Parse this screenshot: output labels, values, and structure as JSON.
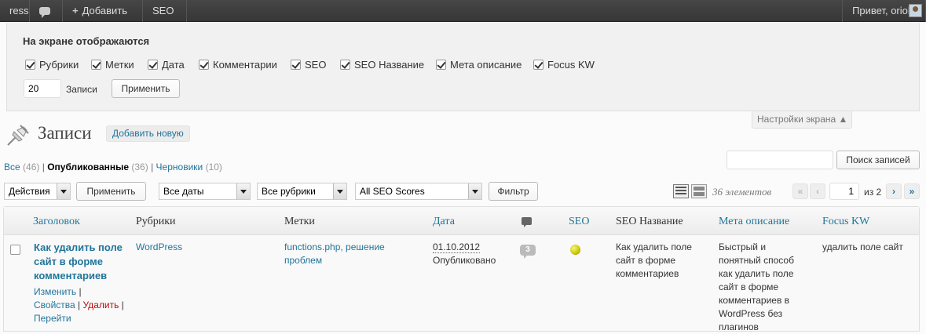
{
  "adminbar": {
    "wp_label": "ress",
    "new_label": "Добавить",
    "seo_label": "SEO",
    "greeting": "Привет, oriolo"
  },
  "screen_options": {
    "title": "На экране отображаются",
    "columns": [
      {
        "label": "Рубрики",
        "checked": true
      },
      {
        "label": "Метки",
        "checked": true
      },
      {
        "label": "Дата",
        "checked": true
      },
      {
        "label": "Комментарии",
        "checked": true
      },
      {
        "label": "SEO",
        "checked": true
      },
      {
        "label": "SEO Название",
        "checked": true
      },
      {
        "label": "Мета описание",
        "checked": true
      },
      {
        "label": "Focus KW",
        "checked": true
      }
    ],
    "per_page_value": "20",
    "per_page_label": "Записи",
    "apply_label": "Применить",
    "tab_label": "Настройки экрана ▲"
  },
  "page": {
    "title": "Записи",
    "add_new": "Добавить новую"
  },
  "views": {
    "all_label": "Все",
    "all_count": "(46)",
    "published_label": "Опубликованные",
    "published_count": "(36)",
    "drafts_label": "Черновики",
    "drafts_count": "(10)",
    "separator": "|"
  },
  "search": {
    "value": "",
    "button": "Поиск записей"
  },
  "tablenav": {
    "bulk_action": "Действия",
    "apply": "Применить",
    "dates": "Все даты",
    "categories": "Все рубрики",
    "seo_scores": "All SEO Scores",
    "filter": "Фильтр",
    "items_count": "36 элементов",
    "first": "«",
    "prev": "‹",
    "current_page": "1",
    "total_pages": "из 2",
    "next": "›",
    "last": "»"
  },
  "table": {
    "headers": {
      "title": "Заголовок",
      "categories": "Рубрики",
      "tags": "Метки",
      "date": "Дата",
      "seo": "SEO",
      "seo_title": "SEO Название",
      "meta_desc": "Мета описание",
      "focus_kw": "Focus KW"
    },
    "rows": [
      {
        "title": "Как удалить поле сайт в форме комментариев",
        "actions": {
          "edit": "Изменить",
          "properties": "Свойства",
          "delete": "Удалить",
          "view": "Перейти"
        },
        "category": "WordPress",
        "tags": "functions.php, решение проблем",
        "date": "01.10.2012",
        "status": "Опубликовано",
        "comments": "3",
        "seo_score_color": "#c8c800",
        "seo_title": "Как удалить поле сайт в форме комментариев",
        "meta_desc": "Быстрый и понятный способ как удалить поле сайт в форме комментариев в WordPress без плагинов",
        "focus_kw": "удалить поле сайт"
      }
    ]
  }
}
